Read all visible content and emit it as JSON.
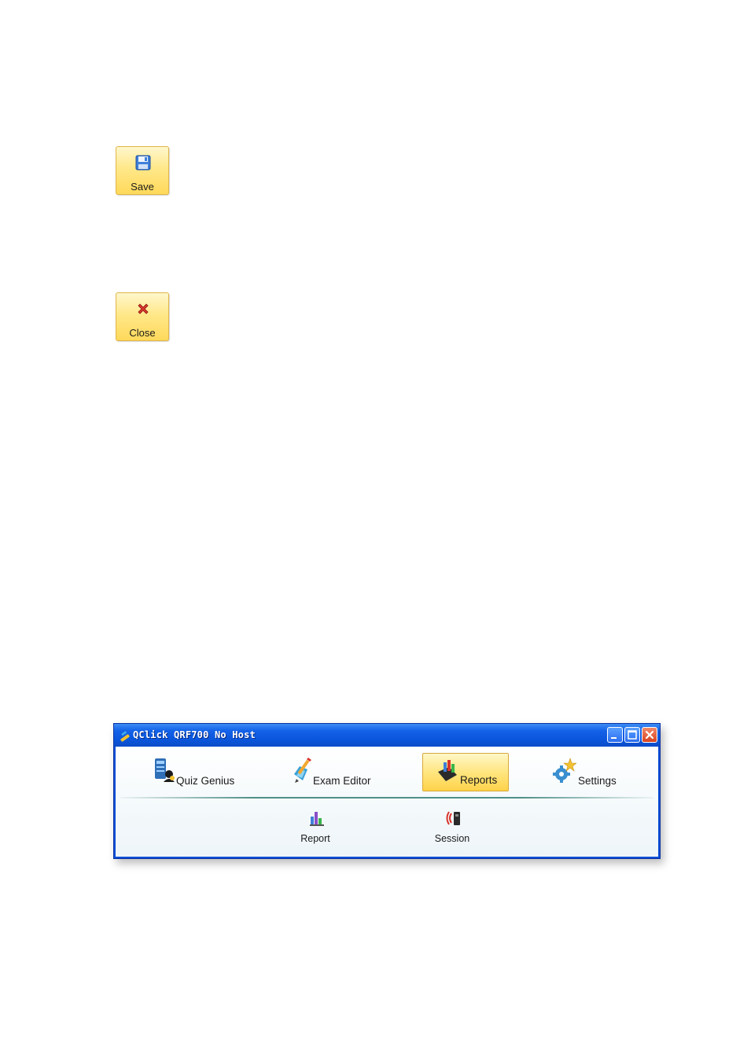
{
  "buttons": {
    "save_label": "Save",
    "close_label": "Close"
  },
  "window": {
    "title": "QClick QRF700 No Host",
    "nav": [
      {
        "label": "Quiz Genius",
        "icon": "quiz-genius-icon"
      },
      {
        "label": "Exam Editor",
        "icon": "exam-editor-icon"
      },
      {
        "label": "Reports",
        "icon": "reports-icon",
        "selected": true
      },
      {
        "label": "Settings",
        "icon": "settings-icon"
      }
    ],
    "sub_items": [
      {
        "label": "Report",
        "icon": "bar-chart-icon"
      },
      {
        "label": "Session",
        "icon": "session-icon"
      }
    ]
  },
  "colors": {
    "titlebar": "#0a55dc",
    "button_yellow": "#ffe88a",
    "selected_tab": "#ffe680",
    "divider": "#4f8f88"
  }
}
